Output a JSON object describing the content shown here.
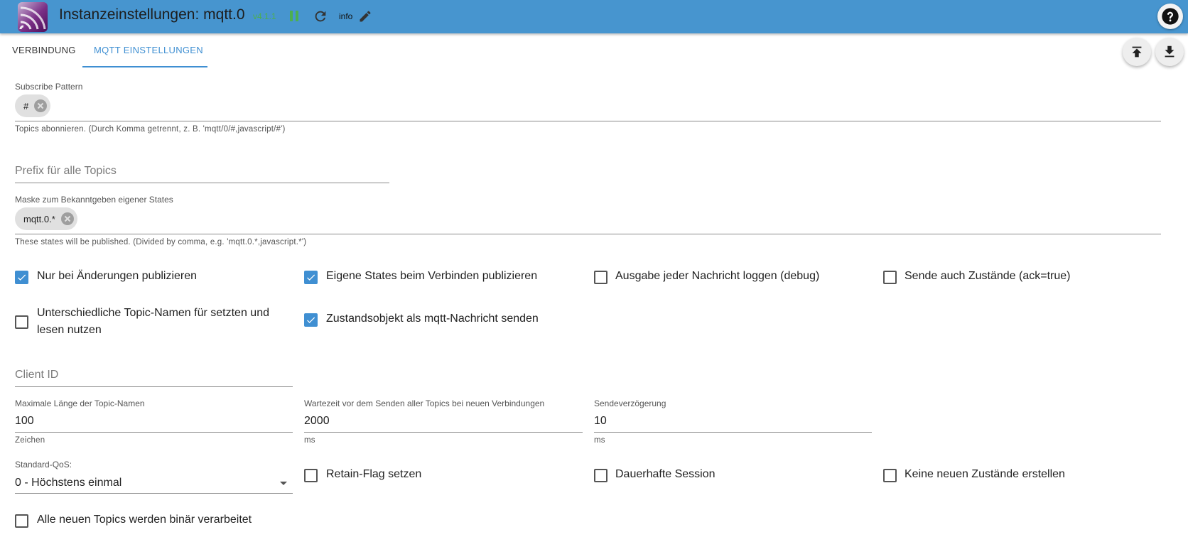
{
  "header": {
    "title": "Instanzeinstellungen: mqtt.0",
    "version": "v4.1.1",
    "info_label": "info",
    "icons": [
      "adapter-logo-icon",
      "pause-icon",
      "reload-icon",
      "edit-icon",
      "help-icon"
    ],
    "colors": {
      "bar": "#4795cf",
      "version": "#4caf50",
      "pause": "#4caf50"
    }
  },
  "tabs": [
    {
      "label": "VERBINDUNG",
      "active": false
    },
    {
      "label": "MQTT EINSTELLUNGEN",
      "active": true
    }
  ],
  "toolbar": {
    "icons": [
      "upload-icon",
      "download-icon"
    ]
  },
  "subscribe": {
    "label": "Subscribe Pattern",
    "chips": [
      "#"
    ],
    "helper": "Topics abonnieren. (Durch Komma getrennt, z. B. 'mqtt/0/#,javascript/#')"
  },
  "prefix": {
    "placeholder": "Prefix für alle Topics",
    "value": ""
  },
  "mask": {
    "label": "Maske zum Bekanntgeben eigener States",
    "chips": [
      "mqtt.0.*"
    ],
    "helper": "These states will be published. (Divided by comma, e.g. 'mqtt.0.*,javascript.*')"
  },
  "checkboxes_row1": [
    {
      "label": "Nur bei Änderungen publizieren",
      "checked": true
    },
    {
      "label": "Eigene States beim Verbinden publizieren",
      "checked": true
    },
    {
      "label": "Ausgabe jeder Nachricht loggen (debug)",
      "checked": false
    },
    {
      "label": "Sende auch Zustände (ack=true)",
      "checked": false
    }
  ],
  "checkboxes_row2": [
    {
      "label": "Unterschiedliche Topic-Namen für setzten und lesen nutzen",
      "checked": false
    },
    {
      "label": "Zustandsobjekt als mqtt-Nachricht senden",
      "checked": true
    }
  ],
  "client_id": {
    "placeholder": "Client ID",
    "value": ""
  },
  "max_topic_length": {
    "label": "Maximale Länge der Topic-Namen",
    "value": "100",
    "helper": "Zeichen"
  },
  "wait_time": {
    "label": "Wartezeit vor dem Senden aller Topics bei neuen Verbindungen",
    "value": "2000",
    "helper": "ms"
  },
  "send_delay": {
    "label": "Sendeverzögerung",
    "value": "10",
    "helper": "ms"
  },
  "qos": {
    "label": "Standard-QoS:",
    "selected": "0 - Höchstens einmal"
  },
  "checkboxes_row3": [
    {
      "label": "Retain-Flag setzen",
      "checked": false
    },
    {
      "label": "Dauerhafte Session",
      "checked": false
    },
    {
      "label": "Keine neuen Zustände erstellen",
      "checked": false
    }
  ],
  "binary_checkbox": {
    "label": "Alle neuen Topics werden binär verarbeitet",
    "checked": false
  },
  "accent_color": "#3f8fd2"
}
